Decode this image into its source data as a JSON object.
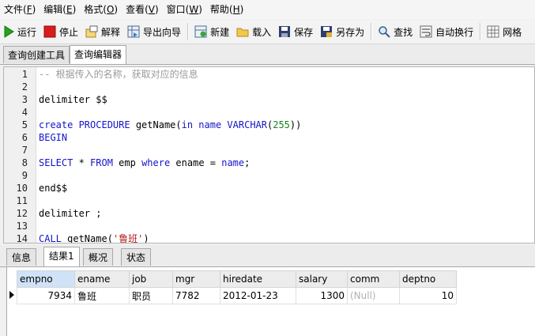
{
  "menu": [
    {
      "label": "文件(",
      "key": "F",
      "tail": ")"
    },
    {
      "label": "编辑(",
      "key": "E",
      "tail": ")"
    },
    {
      "label": "格式(",
      "key": "O",
      "tail": ")"
    },
    {
      "label": "查看(",
      "key": "V",
      "tail": ")"
    },
    {
      "label": "窗口(",
      "key": "W",
      "tail": ")"
    },
    {
      "label": "帮助(",
      "key": "H",
      "tail": ")"
    }
  ],
  "toolbar": {
    "run": "运行",
    "stop": "停止",
    "explain": "解释",
    "export_wizard": "导出向导",
    "new": "新建",
    "load": "载入",
    "save": "保存",
    "save_as": "另存为",
    "find": "查找",
    "word_wrap": "自动换行",
    "grid": "网格"
  },
  "tabs": {
    "query_builder": "查询创建工具",
    "query_editor": "查询编辑器"
  },
  "editor": {
    "line_numbers": [
      "1",
      "2",
      "3",
      "4",
      "5",
      "6",
      "7",
      "8",
      "9",
      "10",
      "11",
      "12",
      "13",
      "14"
    ],
    "line1": "-- 根据传入的名称，获取对应的信息",
    "line3": "delimiter $$",
    "line5_kw1": "create PROCEDURE",
    "line5_fn": " getName(",
    "line5_kw2": "in name VARCHAR",
    "line5_p1": "(",
    "line5_num": "255",
    "line5_p2": "))",
    "line6": "BEGIN",
    "line8_kw1": "SELECT",
    "line8_t1": " * ",
    "line8_kw2": "FROM",
    "line8_t2": " emp ",
    "line8_kw3": "where",
    "line8_t3": " ename = ",
    "line8_kw4": "name",
    "line8_t4": ";",
    "line10": "end$$",
    "line12": "delimiter ;",
    "line14_kw": "CALL",
    "line14_t1": " getName(",
    "line14_str": "'鲁班'",
    "line14_t2": ")"
  },
  "result_tabs": {
    "info": "信息",
    "result1": "结果1",
    "profile": "概况",
    "status": "状态"
  },
  "result": {
    "columns": [
      "empno",
      "ename",
      "job",
      "mgr",
      "hiredate",
      "salary",
      "comm",
      "deptno"
    ],
    "row": {
      "empno": "7934",
      "ename": "鲁班",
      "job": "职员",
      "mgr": "7782",
      "hiredate": "2012-01-23",
      "salary": "1300",
      "comm": "(Null)",
      "deptno": "10"
    }
  },
  "colors": {
    "keyword": "#1515c9",
    "comment": "#9a9a9a",
    "number": "#178317",
    "string": "#b01c1c"
  }
}
